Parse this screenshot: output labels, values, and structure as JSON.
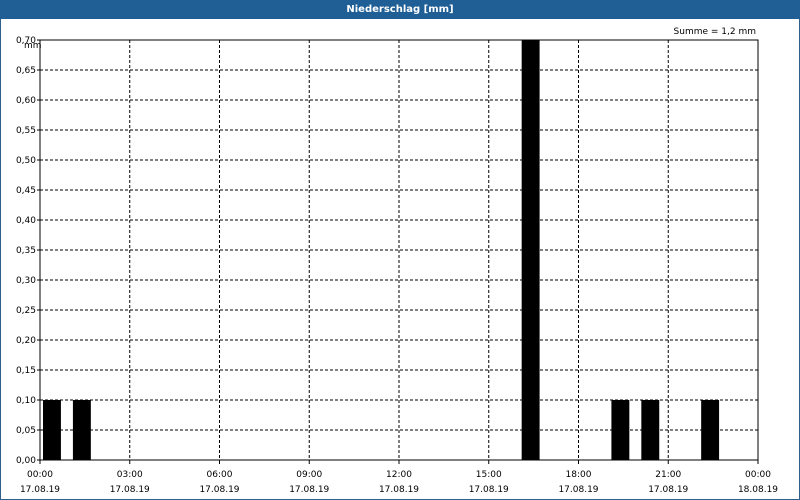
{
  "window": {
    "title": "Niederschlag [mm]"
  },
  "chart_data": {
    "type": "bar",
    "title": "Niederschlag [mm]",
    "ylabel": "mm",
    "annotation": "Summe = 1,2 mm",
    "ylim": [
      0,
      0.7
    ],
    "xlim": [
      "17.08.19 00:00",
      "18.08.19 00:00"
    ],
    "grid": true,
    "y_ticks": [
      "0,00",
      "0,05",
      "0,10",
      "0,15",
      "0,20",
      "0,25",
      "0,30",
      "0,35",
      "0,40",
      "0,45",
      "0,50",
      "0,55",
      "0,60",
      "0,65",
      "0,70"
    ],
    "x_ticks": [
      {
        "time": "00:00",
        "date": "17.08.19"
      },
      {
        "time": "03:00",
        "date": "17.08.19"
      },
      {
        "time": "06:00",
        "date": "17.08.19"
      },
      {
        "time": "09:00",
        "date": "17.08.19"
      },
      {
        "time": "12:00",
        "date": "17.08.19"
      },
      {
        "time": "15:00",
        "date": "17.08.19"
      },
      {
        "time": "18:00",
        "date": "17.08.19"
      },
      {
        "time": "21:00",
        "date": "17.08.19"
      },
      {
        "time": "00:00",
        "date": "18.08.19"
      }
    ],
    "bars": [
      {
        "start": "00:00",
        "end": "01:00",
        "value": 0.1
      },
      {
        "start": "01:00",
        "end": "02:00",
        "value": 0.1
      },
      {
        "start": "16:00",
        "end": "17:00",
        "value": 0.7
      },
      {
        "start": "19:00",
        "end": "20:00",
        "value": 0.1
      },
      {
        "start": "20:00",
        "end": "21:00",
        "value": 0.1
      },
      {
        "start": "22:00",
        "end": "23:00",
        "value": 0.1
      }
    ],
    "bar_color": "#000000"
  }
}
